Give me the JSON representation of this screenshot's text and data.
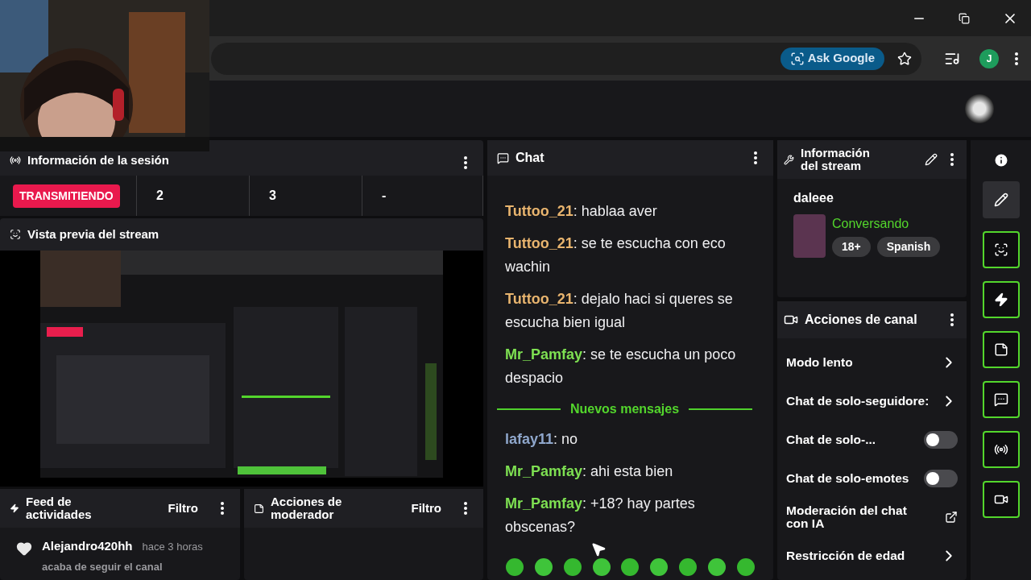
{
  "browser": {
    "ask_button": "Ask Google",
    "profile_initial": "J"
  },
  "session": {
    "title": "Información de la sesión",
    "status": "TRANSMITIENDO",
    "stats": [
      "2",
      "3",
      "-"
    ]
  },
  "preview": {
    "title": "Vista previa del stream",
    "kind": "picture"
  },
  "feed": {
    "title": "Feed de actividades",
    "filter": "Filtro",
    "items": [
      {
        "user": "Alejandro420hh",
        "time": "hace 3 horas",
        "action": "acaba de seguir el canal"
      }
    ]
  },
  "mod_actions": {
    "title": "Acciones de moderador",
    "filter": "Filtro"
  },
  "chat": {
    "title": "Chat",
    "messages": [
      {
        "user": "Tuttoo_21",
        "separator": ":",
        "color": "#e8b46e",
        "text": "hablaa aver"
      },
      {
        "user": "Tuttoo_21",
        "separator": ":",
        "color": "#e8b46e",
        "text": "se te escucha con eco wachin"
      },
      {
        "user": "Tuttoo_21",
        "separator": ":",
        "color": "#e8b46e",
        "text": "dejalo haci si queres se escucha bien igual"
      },
      {
        "user": "Mr_Pamfay",
        "separator": ":",
        "color": "#7ee052",
        "text": "se te escucha un poco despacio"
      }
    ],
    "divider": "Nuevos mensajes",
    "new_messages": [
      {
        "user": "lafay11",
        "separator": ":",
        "color": "#8fa7cc",
        "text": "no"
      },
      {
        "user": "Mr_Pamfay",
        "separator": ":",
        "color": "#7ee052",
        "text": "ahi esta bien"
      },
      {
        "user": "Mr_Pamfay",
        "separator": ":",
        "color": "#7ee052",
        "text": "+18? hay partes obscenas?"
      }
    ]
  },
  "stream_info": {
    "title": "Información del stream",
    "stream_title": "daleee",
    "category": "Conversando",
    "tags": [
      "18+",
      "Spanish"
    ]
  },
  "channel_actions": {
    "title": "Acciones de canal",
    "items": [
      {
        "kind": "arrow",
        "label": "Modo lento"
      },
      {
        "kind": "arrow",
        "label": "Chat de solo-seguidore:"
      },
      {
        "kind": "toggle",
        "label": "Chat de solo-...",
        "on": false
      },
      {
        "kind": "toggle",
        "label": "Chat de solo-emotes",
        "on": false
      },
      {
        "kind": "external",
        "label": "Moderación del chat con IA"
      },
      {
        "kind": "arrow",
        "label": "Restricción de edad"
      }
    ]
  },
  "quick_actions": [
    {
      "kind": "edit",
      "selected": true
    },
    {
      "kind": "preview",
      "selected": false
    },
    {
      "kind": "bolt",
      "selected": false
    },
    {
      "kind": "notes",
      "selected": false
    },
    {
      "kind": "chat",
      "selected": false
    },
    {
      "kind": "broadcast",
      "selected": false
    },
    {
      "kind": "camera",
      "selected": false
    }
  ]
}
